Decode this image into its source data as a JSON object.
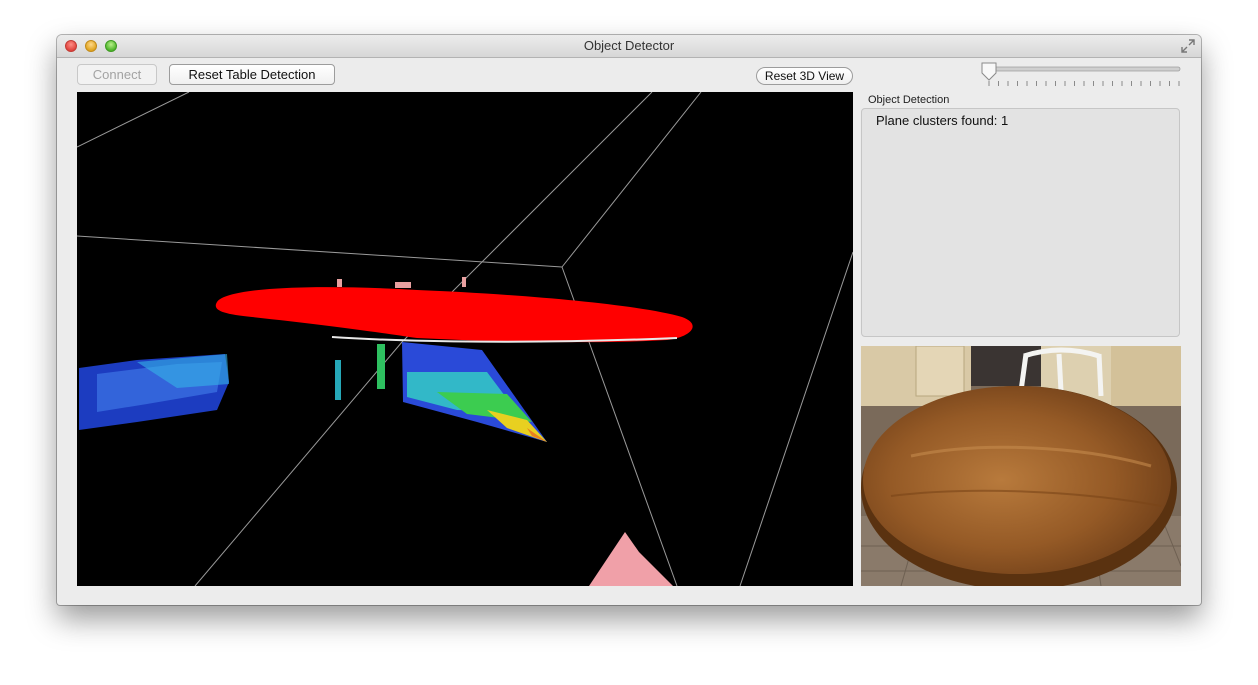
{
  "window": {
    "title": "Object Detector"
  },
  "toolbar": {
    "connect_label": "Connect",
    "reset_table_label": "Reset Table Detection",
    "reset_3d_label": "Reset 3D View"
  },
  "slider": {
    "value": 0.0,
    "tick_count": 21
  },
  "object_detection": {
    "group_label": "Object Detection",
    "status_text": "Plane clusters found:  1"
  },
  "colors": {
    "window_bg": "#ececec",
    "viewport_bg": "#000000",
    "plane_cluster": "#ff0000",
    "panel_bg": "#e3e3e3"
  },
  "icons": {
    "close": "close-icon",
    "minimize": "minimize-icon",
    "zoom": "zoom-icon",
    "fullscreen": "fullscreen-icon"
  }
}
